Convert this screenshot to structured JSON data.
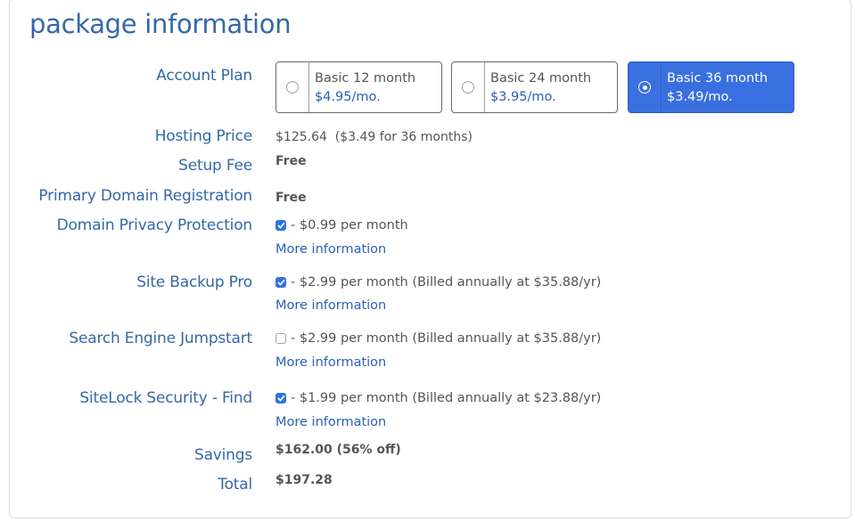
{
  "heading": "package information",
  "account_plan": {
    "label": "Account Plan",
    "options": [
      {
        "name": "Basic 12 month",
        "price": "$4.95/mo.",
        "selected": false
      },
      {
        "name": "Basic 24 month",
        "price": "$3.95/mo.",
        "selected": false
      },
      {
        "name": "Basic 36 month",
        "price": "$3.49/mo.",
        "selected": true
      }
    ]
  },
  "hosting_price": {
    "label": "Hosting Price",
    "value": "$125.64  ($3.49 for 36 months)"
  },
  "setup_fee": {
    "label": "Setup Fee",
    "value": "Free"
  },
  "primary_domain": {
    "label": "Primary Domain Registration",
    "value": "Free"
  },
  "addons": [
    {
      "label": "Domain Privacy Protection",
      "text": "- $0.99 per month",
      "checked": true,
      "link": "More information"
    },
    {
      "label": "Site Backup Pro",
      "text": "- $2.99 per month (Billed annually at $35.88/yr)",
      "checked": true,
      "link": "More information"
    },
    {
      "label": "Search Engine Jumpstart",
      "text": "- $2.99 per month (Billed annually at $35.88/yr)",
      "checked": false,
      "link": "More information"
    },
    {
      "label": "SiteLock Security - Find",
      "text": "- $1.99 per month (Billed annually at $23.88/yr)",
      "checked": true,
      "link": "More information"
    }
  ],
  "savings": {
    "label": "Savings",
    "value": "$162.00 (56% off)"
  },
  "total": {
    "label": "Total",
    "value": "$197.28"
  },
  "colors": {
    "accent": "#3a6fe0",
    "label_blue": "#3468a7",
    "link_blue": "#2a62b4",
    "text_gray": "#555555"
  }
}
